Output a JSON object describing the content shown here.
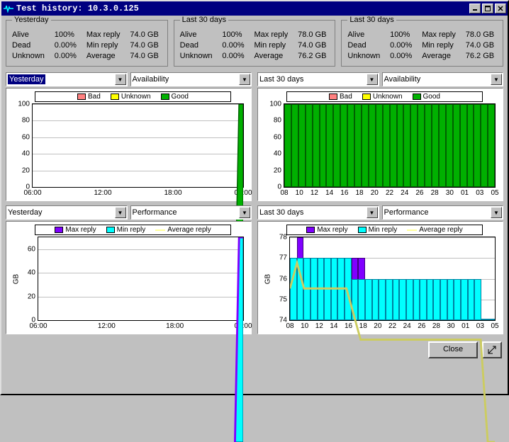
{
  "window": {
    "title": "Test history: 10.3.0.125"
  },
  "stats_groups": [
    {
      "legend": "Yesterday",
      "rows": [
        {
          "k": "Alive",
          "v": "100%",
          "k2": "Max reply",
          "v2": "74.0 GB"
        },
        {
          "k": "Dead",
          "v": "0.00%",
          "k2": "Min reply",
          "v2": "74.0 GB"
        },
        {
          "k": "Unknown",
          "v": "0.00%",
          "k2": "Average",
          "v2": "74.0 GB"
        }
      ]
    },
    {
      "legend": "Last 30 days",
      "rows": [
        {
          "k": "Alive",
          "v": "100%",
          "k2": "Max reply",
          "v2": "78.0 GB"
        },
        {
          "k": "Dead",
          "v": "0.00%",
          "k2": "Min reply",
          "v2": "74.0 GB"
        },
        {
          "k": "Unknown",
          "v": "0.00%",
          "k2": "Average",
          "v2": "76.2 GB"
        }
      ]
    },
    {
      "legend": "Last 30 days",
      "rows": [
        {
          "k": "Alive",
          "v": "100%",
          "k2": "Max reply",
          "v2": "78.0 GB"
        },
        {
          "k": "Dead",
          "v": "0.00%",
          "k2": "Min reply",
          "v2": "74.0 GB"
        },
        {
          "k": "Unknown",
          "v": "0.00%",
          "k2": "Average",
          "v2": "76.2 GB"
        }
      ]
    }
  ],
  "charts": {
    "top_left": {
      "range_select": "Yesterday",
      "metric_select": "Availability",
      "legend_items": [
        {
          "label": "Bad",
          "color": "#ff8080"
        },
        {
          "label": "Unknown",
          "color": "#ffff00"
        },
        {
          "label": "Good",
          "color": "#00b000"
        }
      ]
    },
    "top_right": {
      "range_select": "Last 30 days",
      "metric_select": "Availability",
      "legend_items": [
        {
          "label": "Bad",
          "color": "#ff8080"
        },
        {
          "label": "Unknown",
          "color": "#ffff00"
        },
        {
          "label": "Good",
          "color": "#00b000"
        }
      ]
    },
    "bottom_left": {
      "range_select": "Yesterday",
      "metric_select": "Performance",
      "legend_items": [
        {
          "label": "Max reply",
          "color": "#8000ff"
        },
        {
          "label": "Min reply",
          "color": "#00ffff"
        },
        {
          "label": "Average reply",
          "color": "#ffff99",
          "line": true
        }
      ],
      "ylabel": "GB"
    },
    "bottom_right": {
      "range_select": "Last 30 days",
      "metric_select": "Performance",
      "legend_items": [
        {
          "label": "Max reply",
          "color": "#8000ff"
        },
        {
          "label": "Min reply",
          "color": "#00ffff"
        },
        {
          "label": "Average reply",
          "color": "#ffff99",
          "line": true
        }
      ],
      "ylabel": "GB"
    }
  },
  "chart_data": [
    {
      "id": "top_left",
      "type": "area",
      "title": "",
      "xlabel": "",
      "ylabel": "",
      "xticks": [
        "06:00",
        "12:00",
        "18:00",
        "00:00"
      ],
      "yticks": [
        0,
        20,
        40,
        60,
        80,
        100
      ],
      "ylim": [
        0,
        100
      ],
      "series": [
        {
          "name": "Good",
          "values_note": "0 until near 00:00 then spike to 100"
        }
      ]
    },
    {
      "id": "top_right",
      "type": "bar",
      "title": "",
      "xlabel": "",
      "ylabel": "",
      "categories": [
        "08",
        "10",
        "12",
        "14",
        "16",
        "18",
        "20",
        "22",
        "24",
        "26",
        "28",
        "30",
        "01",
        "03",
        "05"
      ],
      "yticks": [
        0,
        20,
        40,
        60,
        80,
        100
      ],
      "ylim": [
        0,
        100
      ],
      "series": [
        {
          "name": "Good",
          "values": [
            100,
            100,
            100,
            100,
            100,
            100,
            100,
            100,
            100,
            100,
            100,
            100,
            100,
            100,
            100,
            100,
            100,
            100,
            100,
            100,
            100,
            100,
            100,
            100,
            100,
            100,
            100,
            100,
            100,
            100
          ]
        }
      ]
    },
    {
      "id": "bottom_left",
      "type": "area",
      "title": "",
      "xlabel": "",
      "ylabel": "GB",
      "xticks": [
        "06:00",
        "12:00",
        "18:00",
        "00:00"
      ],
      "yticks": [
        0,
        20,
        40,
        60
      ],
      "ylim": [
        0,
        70
      ],
      "series": [
        {
          "name": "Max reply",
          "values_note": "0 until near 00:00 then spike to ~74"
        },
        {
          "name": "Min reply",
          "values_note": "0 until near 00:00 then spike to ~74"
        },
        {
          "name": "Average reply",
          "values_note": "0 until near 00:00 then spike to ~74"
        }
      ]
    },
    {
      "id": "bottom_right",
      "type": "bar",
      "title": "",
      "xlabel": "",
      "ylabel": "GB",
      "categories": [
        "08",
        "10",
        "12",
        "14",
        "16",
        "18",
        "20",
        "22",
        "24",
        "26",
        "28",
        "30",
        "01",
        "03",
        "05"
      ],
      "yticks": [
        74,
        75,
        76,
        77,
        78
      ],
      "ylim": [
        74,
        78
      ],
      "series": [
        {
          "name": "Max reply",
          "values": [
            77,
            78,
            77,
            77,
            77,
            77,
            77,
            77,
            77,
            77,
            77,
            76,
            76,
            76,
            76,
            76,
            76,
            76,
            76,
            76,
            76,
            76,
            76,
            76,
            76,
            76,
            76,
            76,
            74,
            74
          ]
        },
        {
          "name": "Min reply",
          "values": [
            77,
            77,
            77,
            77,
            77,
            77,
            77,
            77,
            77,
            76,
            76,
            76,
            76,
            76,
            76,
            76,
            76,
            76,
            76,
            76,
            76,
            76,
            76,
            76,
            76,
            76,
            76,
            76,
            74,
            74
          ]
        },
        {
          "name": "Average reply",
          "values": [
            77,
            77.5,
            77,
            77,
            77,
            77,
            77,
            77,
            77,
            76.5,
            76,
            76,
            76,
            76,
            76,
            76,
            76,
            76,
            76,
            76,
            76,
            76,
            76,
            76,
            76,
            76,
            76,
            76,
            74,
            74
          ]
        }
      ]
    }
  ],
  "buttons": {
    "close": "Close"
  }
}
